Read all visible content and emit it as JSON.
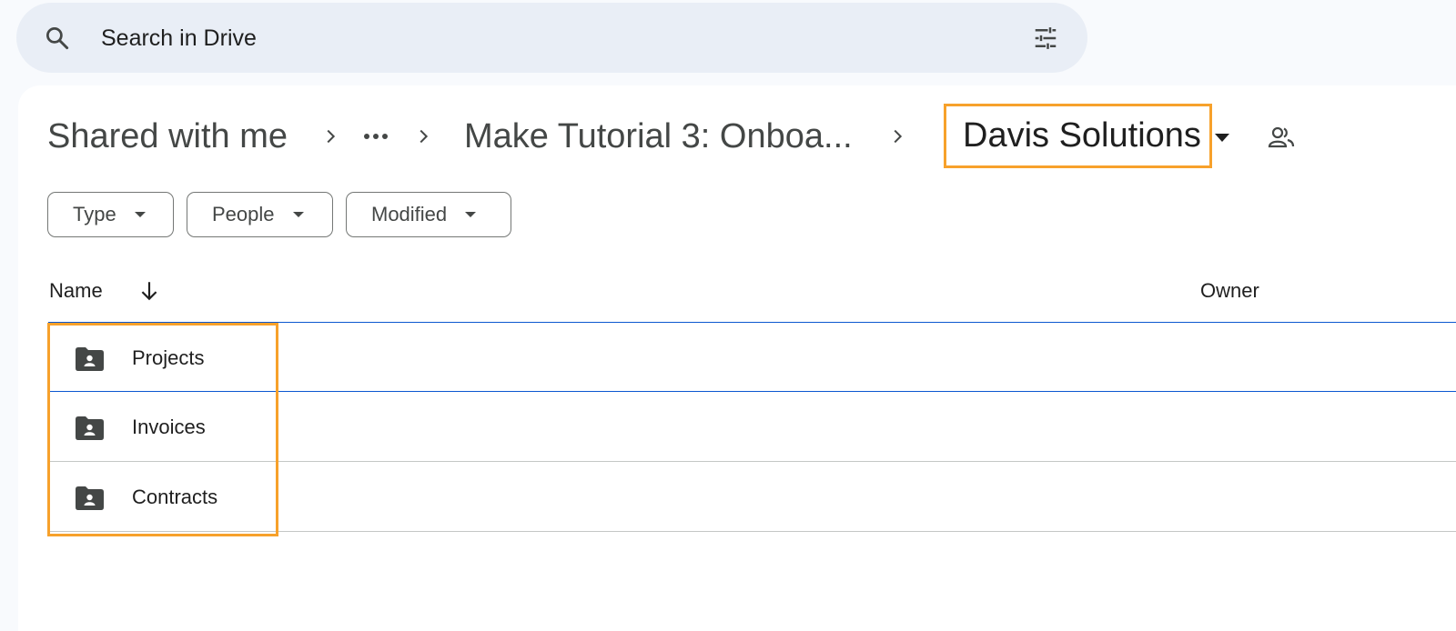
{
  "search": {
    "placeholder": "Search in Drive",
    "search_icon": "search-icon",
    "options_icon": "tune-icon"
  },
  "breadcrumb": {
    "root": "Shared with me",
    "more_icon": "more-horiz-icon",
    "parent": "Make Tutorial 3: Onboa...",
    "current": "Davis Solutions",
    "current_highlight_color": "#f7a12b"
  },
  "filters": [
    {
      "label": "Type"
    },
    {
      "label": "People"
    },
    {
      "label": "Modified"
    }
  ],
  "columns": {
    "name": "Name",
    "owner": "Owner",
    "sort_icon": "arrow-down-icon"
  },
  "files": [
    {
      "name": "Projects",
      "type": "shared-folder",
      "selected": true
    },
    {
      "name": "Invoices",
      "type": "shared-folder",
      "selected": false
    },
    {
      "name": "Contracts",
      "type": "shared-folder",
      "selected": false
    }
  ],
  "colors": {
    "accent": "#0b57d0",
    "highlight": "#f7a12b",
    "search_bg": "#e9eef6"
  }
}
